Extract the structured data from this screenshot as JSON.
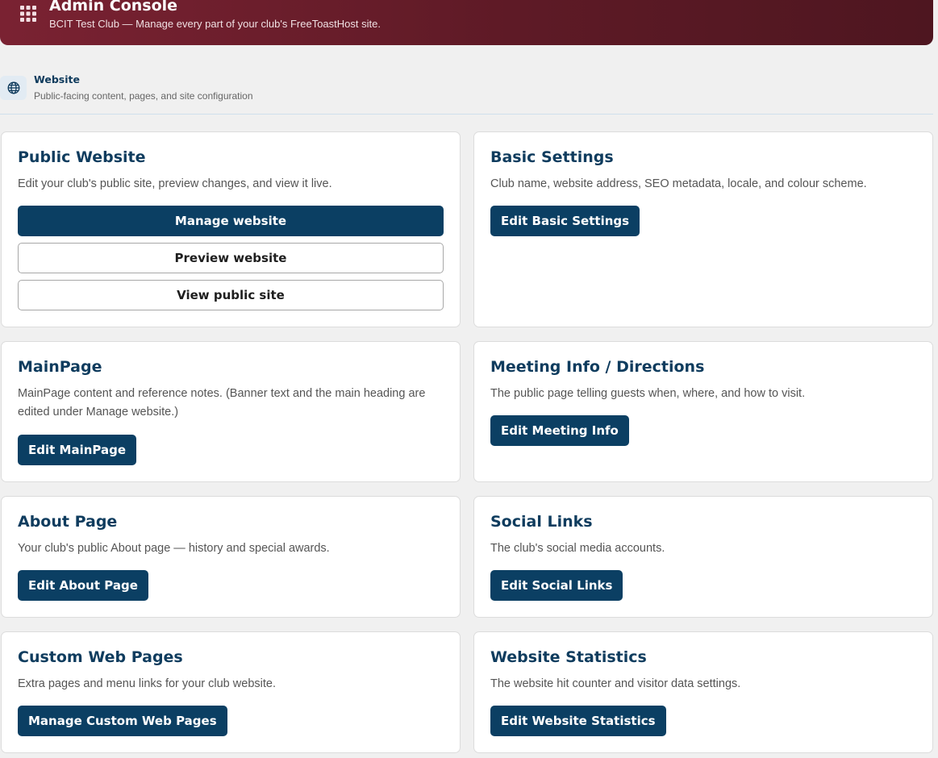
{
  "header": {
    "title": "Admin Console",
    "subtitle": "BCIT Test Club — Manage every part of your club's FreeToastHost site.",
    "icon": "grid-icon"
  },
  "section": {
    "title": "Website",
    "subtitle": "Public-facing content, pages, and site configuration",
    "icon": "globe-icon"
  },
  "cards": {
    "public_website": {
      "title": "Public Website",
      "desc": "Edit your club's public site, preview changes, and view it live.",
      "manage_label": "Manage website",
      "preview_label": "Preview website",
      "view_label": "View public site"
    },
    "basic_settings": {
      "title": "Basic Settings",
      "desc": "Club name, website address, SEO metadata, locale, and colour scheme.",
      "button": "Edit Basic Settings"
    },
    "mainpage": {
      "title": "MainPage",
      "desc": "MainPage content and reference notes. (Banner text and the main heading are edited under Manage website.)",
      "button": "Edit MainPage"
    },
    "meeting_info": {
      "title": "Meeting Info / Directions",
      "desc": "The public page telling guests when, where, and how to visit.",
      "button": "Edit Meeting Info"
    },
    "about_page": {
      "title": "About Page",
      "desc": "Your club's public About page — history and special awards.",
      "button": "Edit About Page"
    },
    "social_links": {
      "title": "Social Links",
      "desc": "The club's social media accounts.",
      "button": "Edit Social Links"
    },
    "custom_pages": {
      "title": "Custom Web Pages",
      "desc": "Extra pages and menu links for your club website.",
      "button": "Manage Custom Web Pages"
    },
    "website_stats": {
      "title": "Website Statistics",
      "desc": "The website hit counter and visitor data settings.",
      "button": "Edit Website Statistics"
    }
  },
  "colors": {
    "header_gradient_start": "#7a2232",
    "header_gradient_end": "#4e1620",
    "primary_button": "#0b3f63",
    "heading": "#0f3c5e"
  }
}
